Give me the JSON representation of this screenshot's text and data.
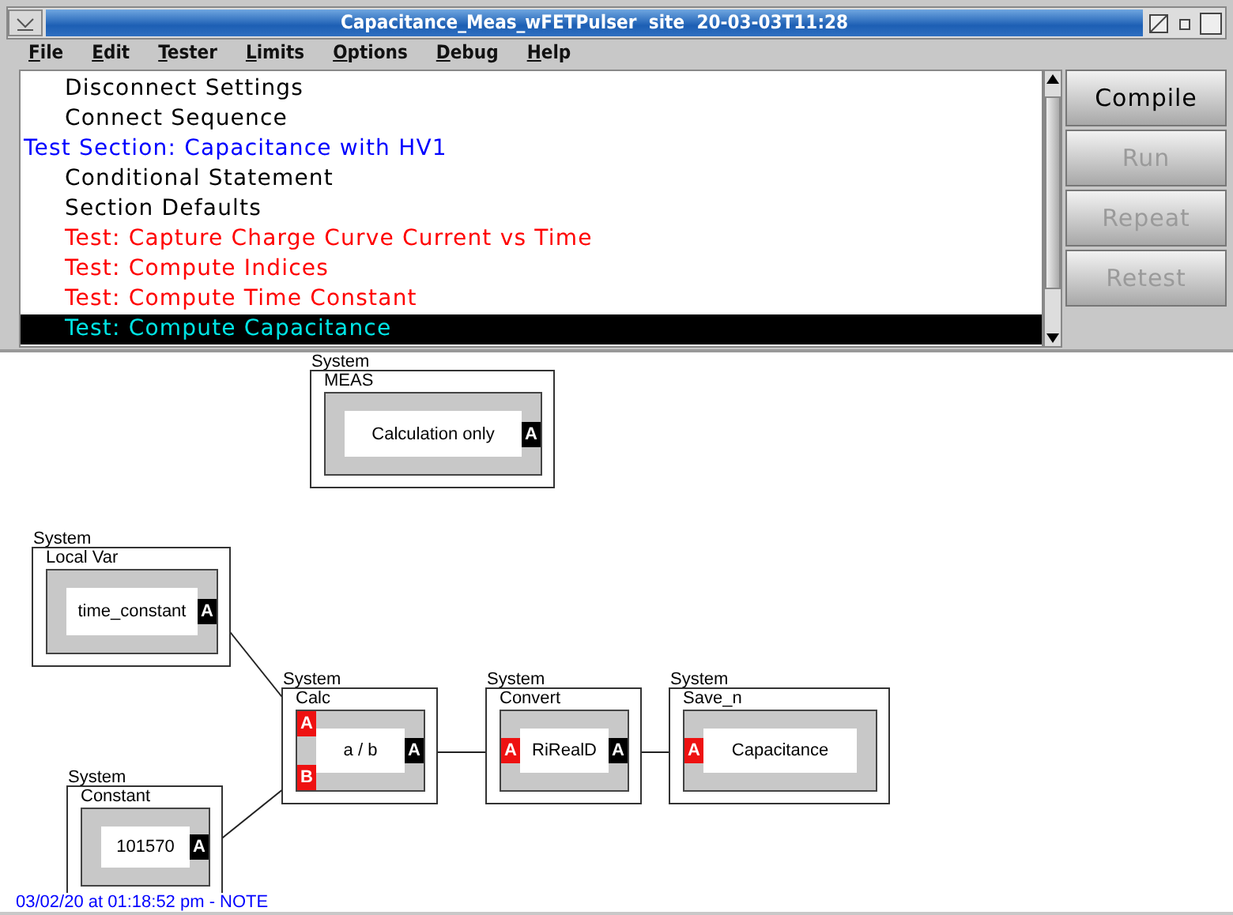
{
  "window": {
    "title": "Capacitance_Meas_wFETPulser site 20-03-03T11:28"
  },
  "menu": [
    "File",
    "Edit",
    "Tester",
    "Limits",
    "Options",
    "Debug",
    "Help"
  ],
  "sequence": {
    "items": [
      {
        "kind": "setting",
        "label": "Disconnect Settings",
        "selected": false
      },
      {
        "kind": "setting",
        "label": "Connect Sequence",
        "selected": false
      },
      {
        "kind": "section",
        "label": "Test Section: Capacitance with HV1",
        "selected": false
      },
      {
        "kind": "setting",
        "label": "Conditional Statement",
        "selected": false
      },
      {
        "kind": "setting",
        "label": "Section Defaults",
        "selected": false
      },
      {
        "kind": "test",
        "label": "Test: Capture Charge Curve Current vs Time",
        "selected": false
      },
      {
        "kind": "test",
        "label": "Test: Compute Indices",
        "selected": false
      },
      {
        "kind": "test",
        "label": "Test: Compute Time Constant",
        "selected": false
      },
      {
        "kind": "test",
        "label": "Test: Compute Capacitance",
        "selected": true
      }
    ]
  },
  "buttons": [
    {
      "label": "Compile",
      "disabled": false
    },
    {
      "label": "Run",
      "disabled": true
    },
    {
      "label": "Repeat",
      "disabled": true
    },
    {
      "label": "Retest",
      "disabled": true
    }
  ],
  "diagram": {
    "nodes": [
      {
        "system": "System",
        "title": "MEAS",
        "label": "Calculation only",
        "ports": [
          {
            "kind": "output",
            "label": "A"
          }
        ]
      },
      {
        "system": "System",
        "title": "Local Var",
        "label": "time_constant",
        "ports": [
          {
            "kind": "output",
            "label": "A"
          }
        ]
      },
      {
        "system": "System",
        "title": "Calc",
        "label": "a / b",
        "ports": [
          {
            "kind": "input",
            "label": "A"
          },
          {
            "kind": "input",
            "label": "B"
          },
          {
            "kind": "output",
            "label": "A"
          }
        ]
      },
      {
        "system": "System",
        "title": "Convert",
        "label": "RiRealD",
        "ports": [
          {
            "kind": "input",
            "label": "A"
          },
          {
            "kind": "output",
            "label": "A"
          }
        ]
      },
      {
        "system": "System",
        "title": "Save_n",
        "label": "Capacitance",
        "ports": [
          {
            "kind": "input",
            "label": "A"
          }
        ]
      },
      {
        "system": "System",
        "title": "Constant",
        "label": "101570",
        "ports": [
          {
            "kind": "output",
            "label": "A"
          }
        ]
      }
    ]
  },
  "status_bar": "03/02/20 at 01:18:52 pm - NOTE"
}
